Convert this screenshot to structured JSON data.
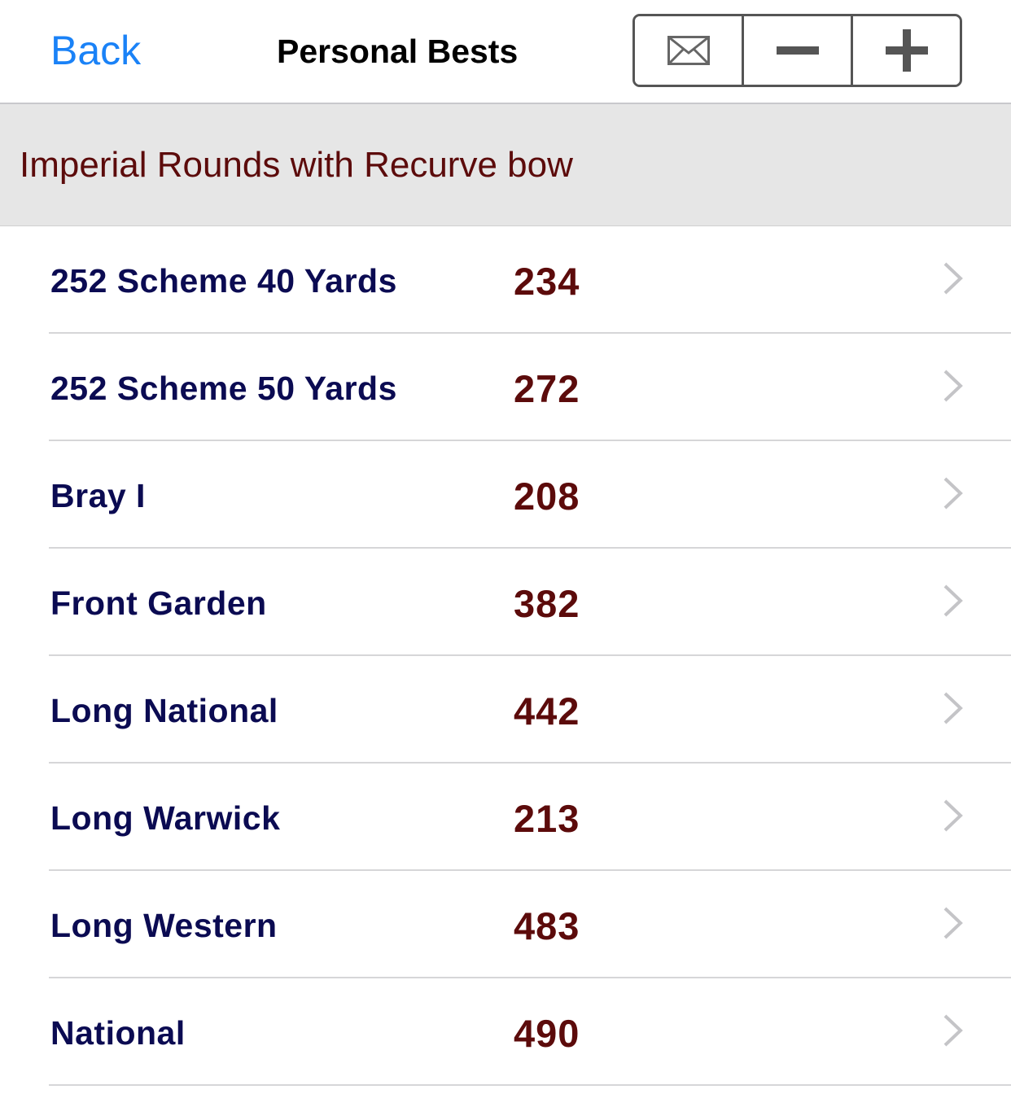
{
  "navbar": {
    "back_label": "Back",
    "title": "Personal Bests",
    "actions": [
      {
        "name": "email",
        "icon": "envelope-icon"
      },
      {
        "name": "remove",
        "icon": "minus-icon"
      },
      {
        "name": "add",
        "icon": "plus-icon"
      }
    ]
  },
  "section": {
    "title": "Imperial Rounds with Recurve bow"
  },
  "rounds": [
    {
      "name": "252 Scheme 40 Yards",
      "score": "234"
    },
    {
      "name": "252 Scheme 50 Yards",
      "score": "272"
    },
    {
      "name": "Bray I",
      "score": "208"
    },
    {
      "name": "Front Garden",
      "score": "382"
    },
    {
      "name": "Long National",
      "score": "442"
    },
    {
      "name": "Long Warwick",
      "score": "213"
    },
    {
      "name": "Long Western",
      "score": "483"
    },
    {
      "name": "National",
      "score": "490"
    }
  ],
  "colors": {
    "accent": "#1a82f7",
    "round_name": "#0b0b52",
    "score": "#5c0b0b",
    "section_bg": "#e6e6e6"
  }
}
